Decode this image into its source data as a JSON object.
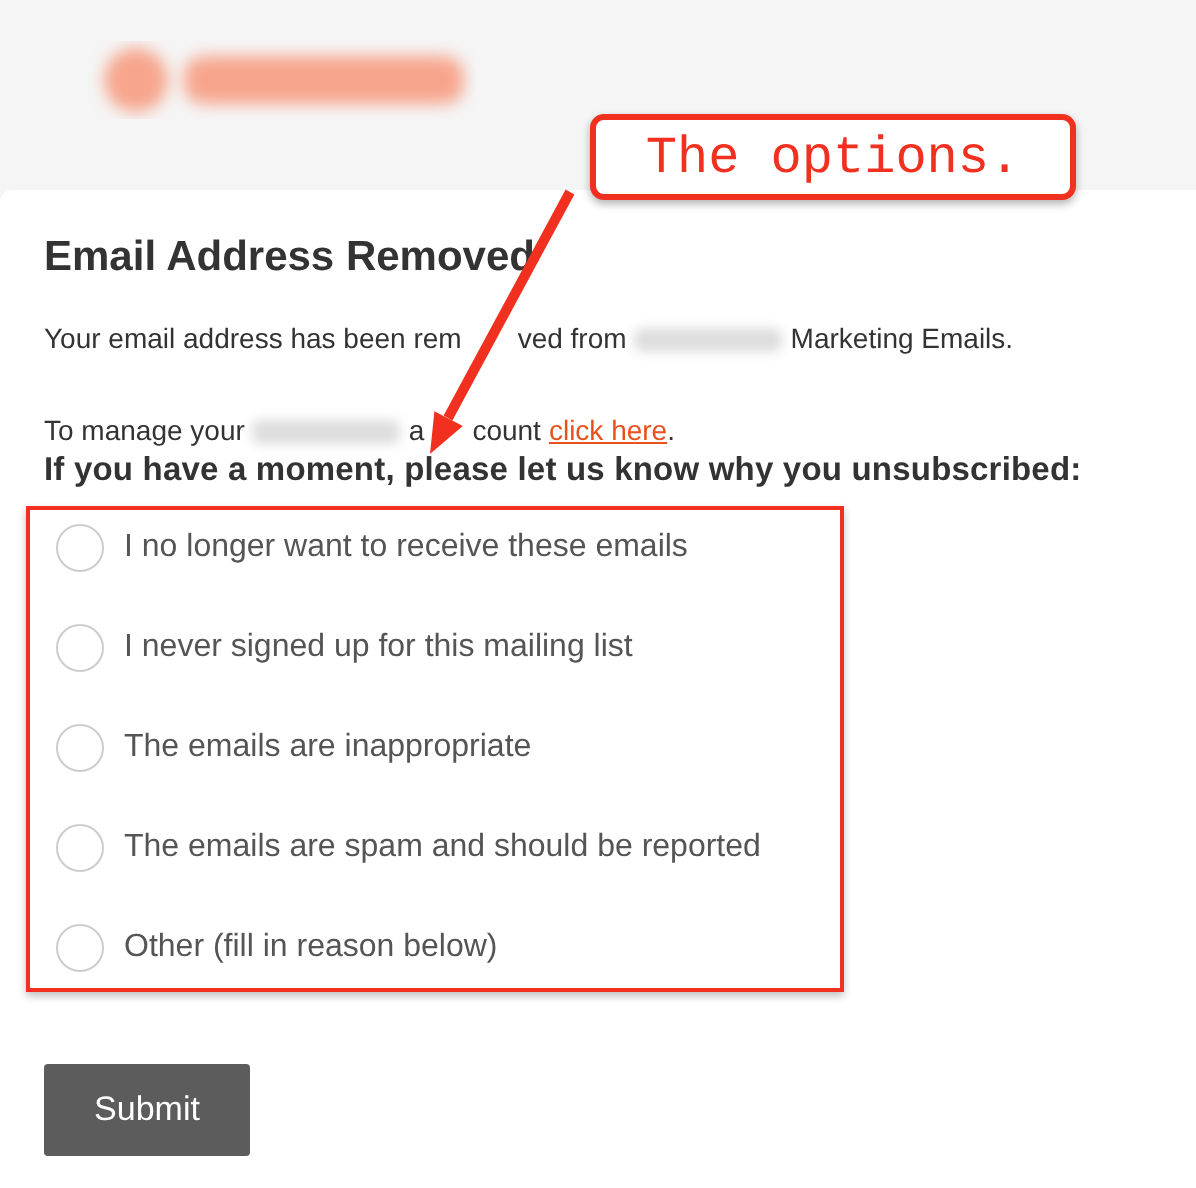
{
  "page": {
    "title": "Email Address Removed",
    "removed_before": "Your email address has been rem",
    "removed_middle": "ved from",
    "removed_after": "Marketing Emails.",
    "manage_before": "To manage your",
    "manage_after": "a",
    "manage_after_2": "count",
    "manage_link": "click here",
    "manage_end": ".",
    "question": "If you have a moment, please let us know why you unsubscribed:"
  },
  "options": [
    {
      "label": "I no longer want to receive these emails",
      "selected": false
    },
    {
      "label": "I never signed up for this mailing list",
      "selected": false
    },
    {
      "label": "The emails are inappropriate",
      "selected": false
    },
    {
      "label": "The emails are spam and should be reported",
      "selected": false
    },
    {
      "label": "Other (fill in reason below)",
      "selected": false
    }
  ],
  "submit": "Submit",
  "annotation": {
    "text": "The options."
  }
}
